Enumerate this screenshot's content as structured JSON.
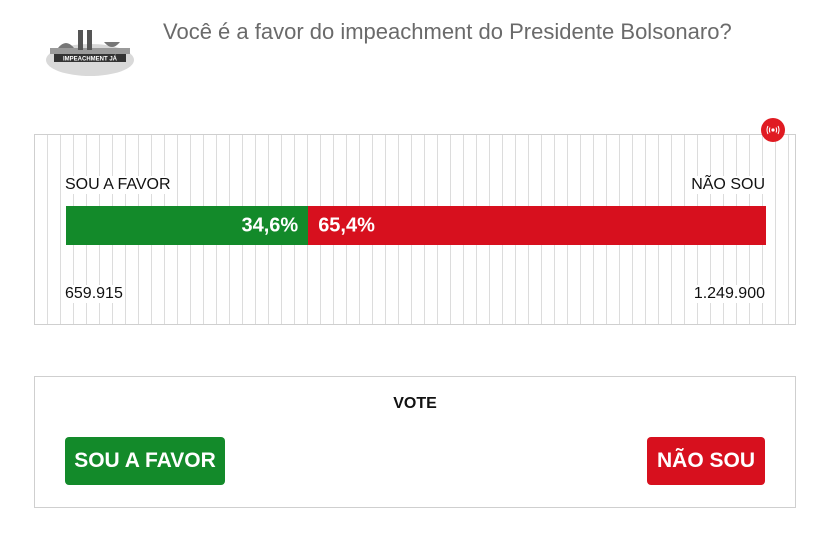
{
  "poll": {
    "question": "Você é a favor do impeachment do Presidente Bolsonaro?"
  },
  "logo": {
    "icon": "congress-building-logo",
    "text": "IMPEACHMENT JÁ"
  },
  "live_indicator": {
    "icon": "broadcast-icon",
    "color": "#e01b22"
  },
  "results": {
    "favor": {
      "label": "SOU A FAVOR",
      "percent": 34.6,
      "percent_text": "34,6%",
      "count": "659.915",
      "color": "#138a2a"
    },
    "against": {
      "label": "NÃO SOU",
      "percent": 65.4,
      "percent_text": "65,4%",
      "count": "1.249.900",
      "color": "#d7101e"
    }
  },
  "vote": {
    "title": "VOTE",
    "favor_button": "SOU A FAVOR",
    "against_button": "NÃO SOU"
  }
}
